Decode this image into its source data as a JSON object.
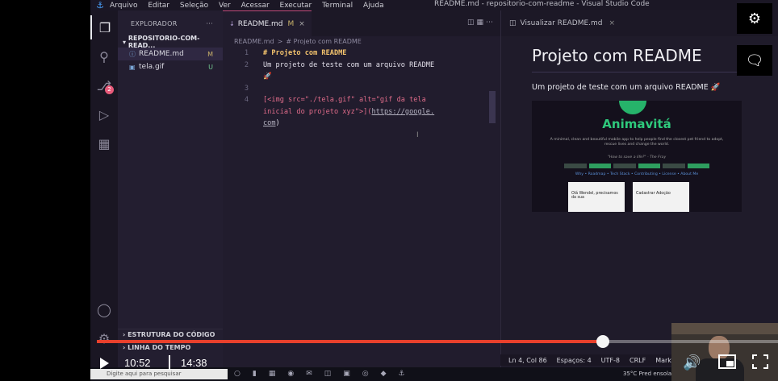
{
  "titlebar": {
    "menu": [
      "Arquivo",
      "Editar",
      "Seleção",
      "Ver",
      "Acessar",
      "Executar",
      "Terminal",
      "Ajuda"
    ],
    "title": "README.md - repositorio-com-readme - Visual Studio Code"
  },
  "sidebar": {
    "header": "EXPLORADOR",
    "more": "···",
    "folder": "REPOSITORIO-COM-READ...",
    "files": [
      {
        "name": "README.md",
        "status": "M"
      },
      {
        "name": "tela.gif",
        "status": "U"
      }
    ],
    "outline": "ESTRUTURA DO CÓDIGO",
    "timeline": "LINHA DO TEMPO",
    "scm_badge": "2"
  },
  "editor": {
    "tab_label": "README.md",
    "tab_status": "M",
    "breadcrumb_file": "README.md",
    "breadcrumb_sep": ">",
    "breadcrumb_section": "# Projeto com README",
    "lines": {
      "n1": "1",
      "l1": "# Projeto com README",
      "n2": "2",
      "l2a": "Um projeto de teste com um arquivo README",
      "l2b": "🚀",
      "n3": "3",
      "n4": "4",
      "l4a": "[<img src=\"./tela.gif\" alt=\"gif da tela",
      "l4b": "inicial do projeto xyz\">](",
      "l4c": "https://google.",
      "l4d": "com",
      "l4e": ")"
    }
  },
  "preview": {
    "tab_label": "Visualizar README.md",
    "title": "Projeto com README",
    "text": "Um projeto de teste com um arquivo README 🚀",
    "image": {
      "brand": "Animavitá",
      "desc": "A minimal, clean and beautiful mobile app to help people find the closest pet friend to adopt, rescue lives and change the world.",
      "quote": "\"How to save a life?\" - The Fray",
      "links": "Why • Roadmap • Tech Stack • Contributing • License • About Me",
      "card1": "Olá Wendel, precisamos da sua",
      "card2": "Cadastrar Adoção"
    }
  },
  "statusbar": {
    "position": "Ln 4, Col 86",
    "spaces": "Espaços: 4",
    "encoding": "UTF-8",
    "eol": "CRLF",
    "lang": "Mark"
  },
  "taskbar": {
    "search_placeholder": "Digite aqui para pesquisar",
    "weather": "35°C  Pred ensolarad"
  },
  "player": {
    "current_time": "10:52",
    "duration": "14:38",
    "progress": 0.743,
    "accent": "#e8402c"
  }
}
